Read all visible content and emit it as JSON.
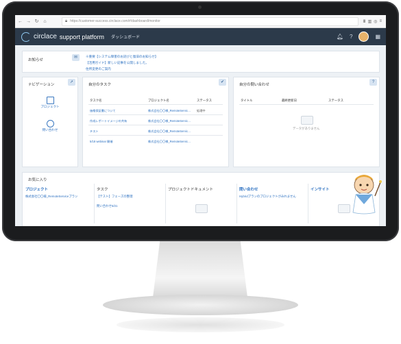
{
  "browser": {
    "url": "https://customer-success.circlace.com/#/dashboard/monitor"
  },
  "app": {
    "logo_text": "circlace",
    "platform_text": "support platform",
    "dashboard_tab": "ダッシュボード"
  },
  "notice": {
    "title": "お知らせ",
    "items": [
      "※重要【システム障害のお詫びと復旧のお知らせ】",
      "【活用ガイド】新しい記事を公開しました。",
      "住所変更のご案内"
    ]
  },
  "navigation": {
    "title": "ナビゲーション",
    "links": [
      "プロジェクト",
      "問い合わせ"
    ]
  },
  "tasks": {
    "title": "自分のタスク",
    "columns": [
      "タスク名",
      "プロジェクト名",
      "ステータス"
    ],
    "rows": [
      [
        "価格保証書について",
        "株式会社〇〇様_RemoteServic…",
        "処理中"
      ],
      [
        "作成レポートイメージの共有",
        "株式会社〇〇様_RemoteServic…",
        ""
      ],
      [
        "テスト",
        "株式会社〇〇様_RemoteServic…",
        ""
      ],
      [
        "5/18 webinar 開催",
        "株式会社〇〇様_RemoteServic…",
        ""
      ]
    ]
  },
  "inquiries": {
    "title": "自分の問い合わせ",
    "columns": [
      "タイトル",
      "最終更新日",
      "ステータス"
    ],
    "empty_text": "データがありません"
  },
  "favorites": {
    "title": "お気に入り",
    "columns": [
      {
        "heading": "プロジェクト",
        "items": [
          "株式会社〇〇様_RemoteServiceプラン"
        ]
      },
      {
        "heading": "タスク",
        "items": [
          "【テスト】フェーズの整理",
          "問い合わせ5/21"
        ]
      },
      {
        "heading": "プロジェクトドキュメント",
        "items": []
      },
      {
        "heading": "問い合わせ",
        "items": [
          "Hybridプランのプロジェクトがみれません"
        ]
      },
      {
        "heading": "インサイト",
        "items": []
      }
    ]
  },
  "colors": {
    "appbar": "#2c3a4a",
    "link": "#2a6fc0",
    "background": "#edf1f5"
  }
}
